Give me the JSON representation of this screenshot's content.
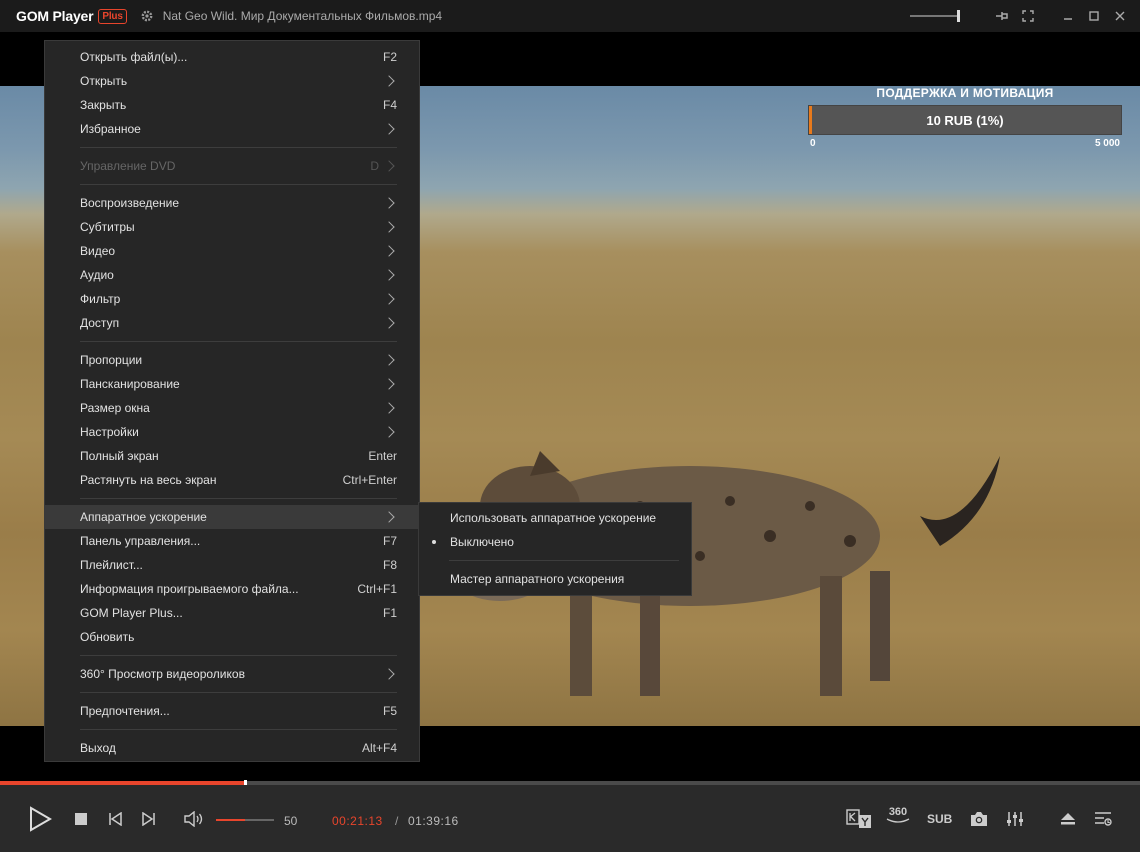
{
  "titlebar": {
    "app_name": "GOM Player",
    "app_badge": "Plus",
    "file_title": "Nat Geo Wild. Мир Документальных Фильмов.mp4"
  },
  "overlay": {
    "title": "ПОДДЕРЖКА И МОТИВАЦИЯ",
    "bar_text": "10 RUB (1%)",
    "progress_percent": 1,
    "min": "0",
    "max": "5 000"
  },
  "menu": {
    "groups": [
      [
        {
          "label": "Открыть файл(ы)...",
          "shortcut": "F2"
        },
        {
          "label": "Открыть",
          "submenu": true
        },
        {
          "label": "Закрыть",
          "shortcut": "F4"
        },
        {
          "label": "Избранное",
          "submenu": true
        }
      ],
      [
        {
          "label": "Управление DVD",
          "shortcut": "D",
          "submenu": true,
          "disabled": true
        }
      ],
      [
        {
          "label": "Воспроизведение",
          "submenu": true
        },
        {
          "label": "Субтитры",
          "submenu": true
        },
        {
          "label": "Видео",
          "submenu": true
        },
        {
          "label": "Аудио",
          "submenu": true
        },
        {
          "label": "Фильтр",
          "submenu": true
        },
        {
          "label": "Доступ",
          "submenu": true
        }
      ],
      [
        {
          "label": "Пропорции",
          "submenu": true
        },
        {
          "label": "Пансканирование",
          "submenu": true
        },
        {
          "label": "Размер окна",
          "submenu": true
        },
        {
          "label": "Настройки",
          "submenu": true
        },
        {
          "label": "Полный экран",
          "shortcut": "Enter"
        },
        {
          "label": "Растянуть на весь экран",
          "shortcut": "Ctrl+Enter"
        }
      ],
      [
        {
          "label": "Аппаратное ускорение",
          "submenu": true,
          "highlighted": true
        },
        {
          "label": "Панель управления...",
          "shortcut": "F7"
        },
        {
          "label": "Плейлист...",
          "shortcut": "F8"
        },
        {
          "label": "Информация проигрываемого файла...",
          "shortcut": "Ctrl+F1"
        },
        {
          "label": "GOM Player Plus...",
          "shortcut": "F1"
        },
        {
          "label": "Обновить"
        }
      ],
      [
        {
          "label": "360° Просмотр видеороликов",
          "submenu": true
        }
      ],
      [
        {
          "label": "Предпочтения...",
          "shortcut": "F5"
        }
      ],
      [
        {
          "label": "Выход",
          "shortcut": "Alt+F4"
        }
      ]
    ]
  },
  "submenu": {
    "groups": [
      [
        {
          "label": "Использовать аппаратное ускорение"
        },
        {
          "label": "Выключено",
          "checked": true
        }
      ],
      [
        {
          "label": "Мастер аппаратного ускорения"
        }
      ]
    ]
  },
  "controls": {
    "volume_value": "50",
    "volume_fraction": 0.5,
    "time_current": "00:21:13",
    "time_separator": "/",
    "time_total": "01:39:16",
    "seek_fraction": 0.2137,
    "sub_label": "SUB",
    "deg360_label": "360",
    "accent": "#e8452c"
  }
}
